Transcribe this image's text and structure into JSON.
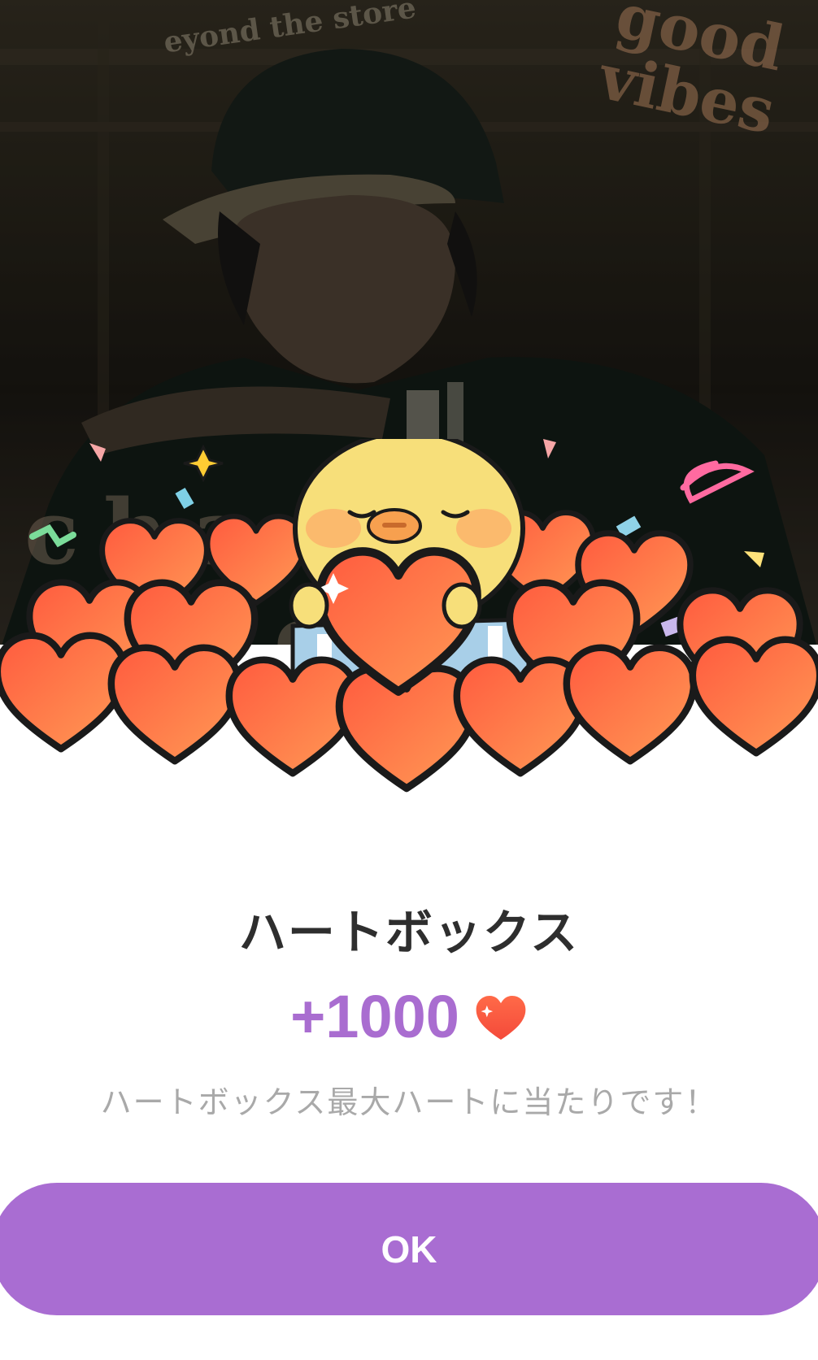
{
  "background": {
    "sticker_top": "eyond the store",
    "sticker_vibes": "good vibes",
    "sticker_bottom": "chaos check"
  },
  "dialog": {
    "title": "ハートボックス",
    "reward_amount": "+1000",
    "reward_icon": "heart-icon",
    "message": "ハートボックス最大ハートに当たりです！",
    "ok_label": "OK"
  },
  "colors": {
    "accent": "#a96dd2",
    "reward_text": "#a96dd0",
    "heart": "#f2543e",
    "title_text": "#2e2e2e",
    "message_text": "#a9a9a9"
  }
}
